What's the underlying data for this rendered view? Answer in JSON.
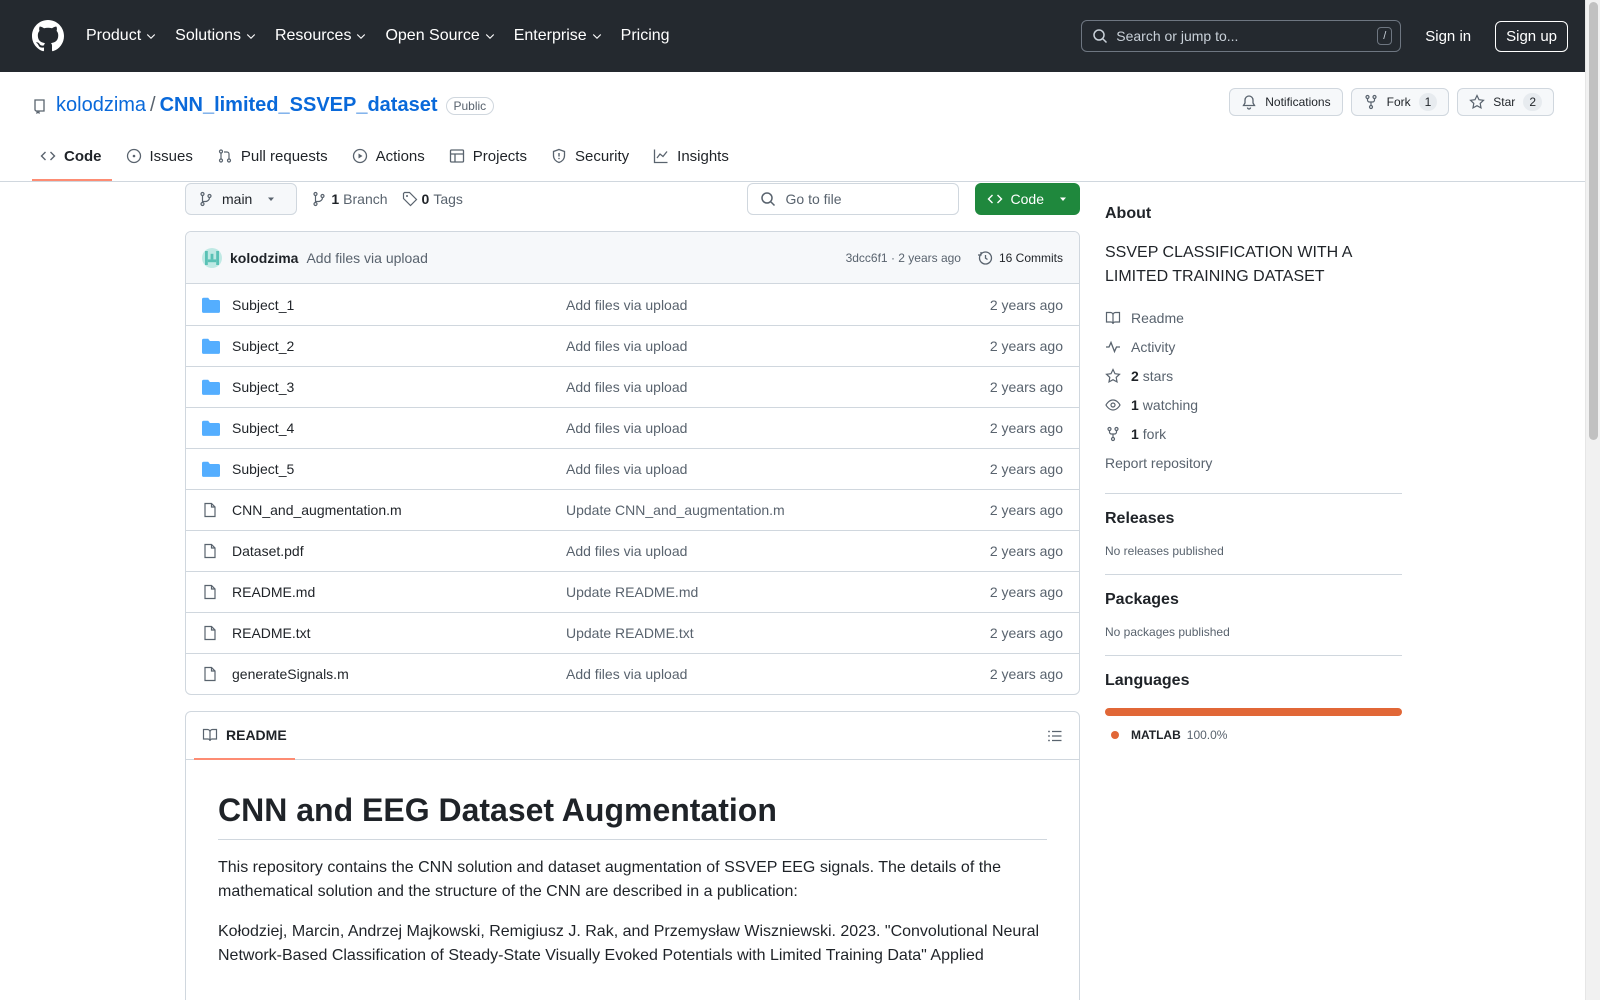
{
  "header": {
    "nav": [
      "Product",
      "Solutions",
      "Resources",
      "Open Source",
      "Enterprise",
      "Pricing"
    ],
    "search_placeholder": "Search or jump to...",
    "search_kbd": "/",
    "signin": "Sign in",
    "signup": "Sign up"
  },
  "repo": {
    "owner": "kolodzima",
    "sep": "/",
    "name": "CNN_limited_SSVEP_dataset",
    "visibility": "Public",
    "notifications": "Notifications",
    "fork_label": "Fork",
    "fork_count": "1",
    "star_label": "Star",
    "star_count": "2"
  },
  "tabs": [
    "Code",
    "Issues",
    "Pull requests",
    "Actions",
    "Projects",
    "Security",
    "Insights"
  ],
  "toolbar": {
    "branch": "main",
    "branches_count": "1",
    "branches_label": "Branch",
    "tags_count": "0",
    "tags_label": "Tags",
    "goto_placeholder": "Go to file",
    "code_label": "Code"
  },
  "commit": {
    "author": "kolodzima",
    "message": "Add files via upload",
    "hash_time": "3dcc6f1 · 2 years ago",
    "commits": "16 Commits"
  },
  "files": [
    {
      "name": "Subject_1",
      "type": "folder",
      "message": "Add files via upload",
      "date": "2 years ago"
    },
    {
      "name": "Subject_2",
      "type": "folder",
      "message": "Add files via upload",
      "date": "2 years ago"
    },
    {
      "name": "Subject_3",
      "type": "folder",
      "message": "Add files via upload",
      "date": "2 years ago"
    },
    {
      "name": "Subject_4",
      "type": "folder",
      "message": "Add files via upload",
      "date": "2 years ago"
    },
    {
      "name": "Subject_5",
      "type": "folder",
      "message": "Add files via upload",
      "date": "2 years ago"
    },
    {
      "name": "CNN_and_augmentation.m",
      "type": "file",
      "message": "Update CNN_and_augmentation.m",
      "date": "2 years ago"
    },
    {
      "name": "Dataset.pdf",
      "type": "file",
      "message": "Add files via upload",
      "date": "2 years ago"
    },
    {
      "name": "README.md",
      "type": "file",
      "message": "Update README.md",
      "date": "2 years ago"
    },
    {
      "name": "README.txt",
      "type": "file",
      "message": "Update README.txt",
      "date": "2 years ago"
    },
    {
      "name": "generateSignals.m",
      "type": "file",
      "message": "Add files via upload",
      "date": "2 years ago"
    }
  ],
  "readme": {
    "tab": "README",
    "title": "CNN and EEG Dataset Augmentation",
    "p1": "This repository contains the CNN solution and dataset augmentation of SSVEP EEG signals. The details of the mathematical solution and the structure of the CNN are described in a publication:",
    "p2": "Kołodziej, Marcin, Andrzej Majkowski, Remigiusz J. Rak, and Przemysław Wiszniewski. 2023. \"Convolutional Neural Network-Based Classification of Steady-State Visually Evoked Potentials with Limited Training Data\" Applied"
  },
  "sidebar": {
    "about": "About",
    "description": "SSVEP CLASSIFICATION WITH A LIMITED TRAINING DATASET",
    "readme": "Readme",
    "activity": "Activity",
    "stars_count": "2",
    "stars_label": "stars",
    "watching_count": "1",
    "watching_label": "watching",
    "fork_count": "1",
    "fork_label": "fork",
    "report": "Report repository",
    "releases": "Releases",
    "no_releases": "No releases published",
    "packages": "Packages",
    "no_packages": "No packages published",
    "languages": "Languages",
    "lang_name": "MATLAB",
    "lang_pct": "100.0%",
    "lang_color": "#e16737"
  },
  "colors": {
    "header_bg": "#24292f",
    "accent": "#0969da",
    "green": "#1f883d",
    "tab_underline": "#fd8c73"
  }
}
